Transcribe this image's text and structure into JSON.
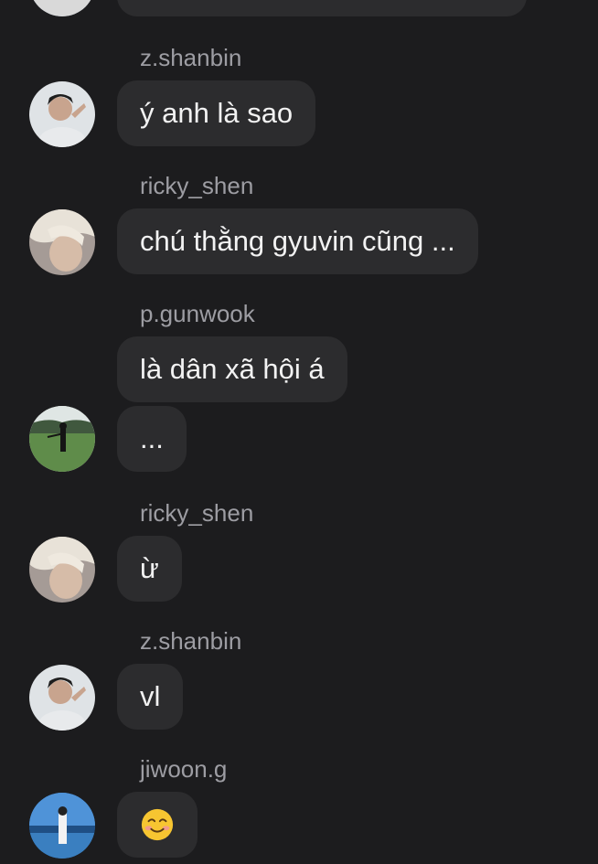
{
  "messages": [
    {
      "sender": "",
      "text": ""
    },
    {
      "sender": "z.shanbin",
      "text": "ý anh là sao"
    },
    {
      "sender": "ricky_shen",
      "text": "chú thằng gyuvin cũng ..."
    },
    {
      "sender": "p.gunwook",
      "text": "là dân xã hội á"
    },
    {
      "sender": "",
      "text": "..."
    },
    {
      "sender": "ricky_shen",
      "text": "ừ"
    },
    {
      "sender": "z.shanbin",
      "text": "vl"
    },
    {
      "sender": "jiwoon.g",
      "text": "☺️",
      "emoji": "smiling-face"
    }
  ],
  "avatars": {
    "z.shanbin": "avatar-light-background-portrait",
    "ricky_shen": "avatar-blond-hair-portrait",
    "p.gunwook": "avatar-golf-field",
    "jiwoon.g": "avatar-sea-sky"
  },
  "colors": {
    "background": "#1c1c1e",
    "bubble": "#2c2c2e",
    "text": "#f2f2f2",
    "sender": "#9d9da3"
  }
}
